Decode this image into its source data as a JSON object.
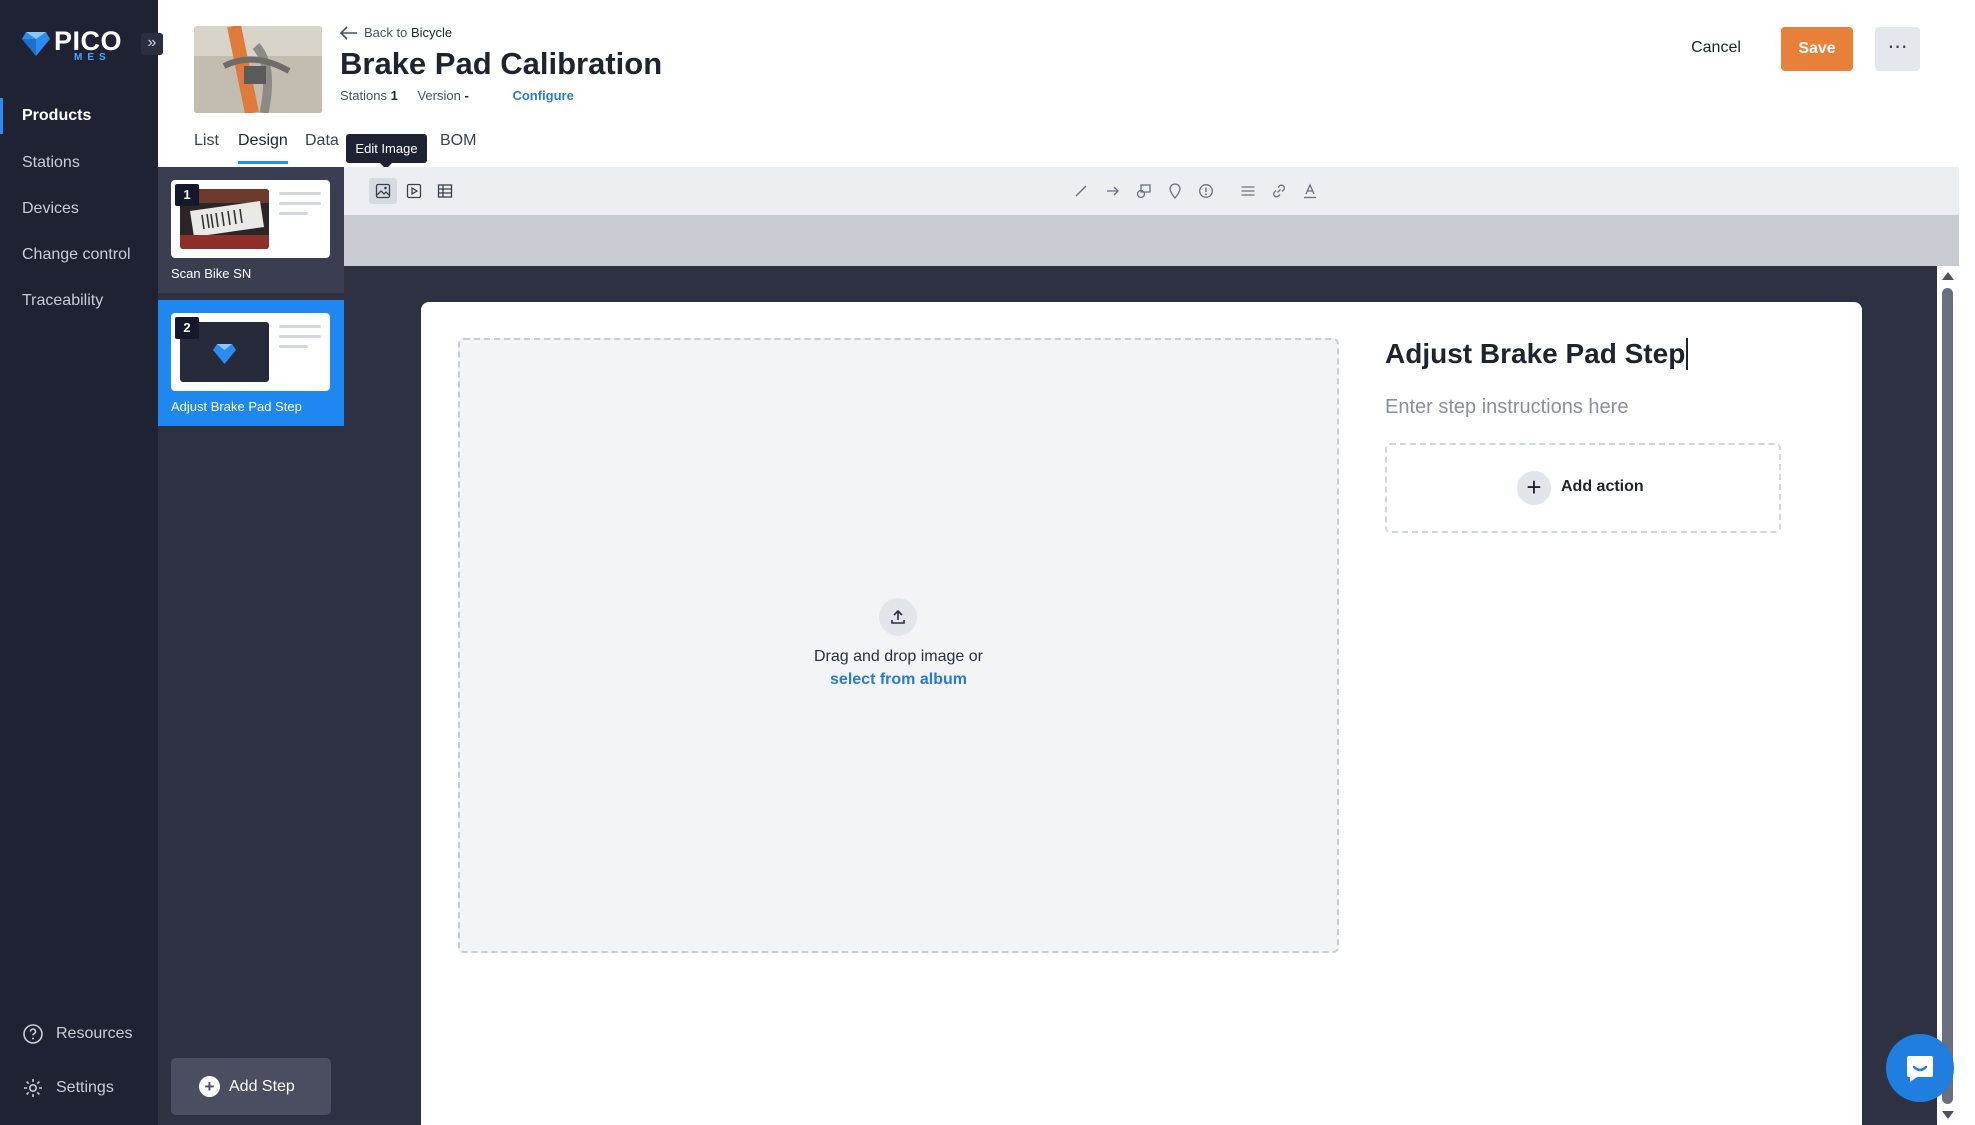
{
  "brand": {
    "name": "PICO",
    "sub": "MES",
    "toggle": "»"
  },
  "nav": {
    "items": [
      "Products",
      "Stations",
      "Devices",
      "Change control",
      "Traceability"
    ],
    "footer": [
      "Resources",
      "Settings"
    ]
  },
  "header": {
    "back_prefix": "Back to",
    "back_target": "Bicycle",
    "title": "Brake Pad Calibration",
    "stations_label": "Stations",
    "stations_value": "1",
    "version_label": "Version",
    "version_value": "-",
    "configure": "Configure",
    "cancel": "Cancel",
    "save": "Save",
    "more": "⋯"
  },
  "tabs": [
    "List",
    "Design",
    "Data",
    "BOM"
  ],
  "tooltip": "Edit Image",
  "steps": [
    {
      "num": "1",
      "label": "Scan Bike SN"
    },
    {
      "num": "2",
      "label": "Adjust Brake Pad Step"
    }
  ],
  "add_step": "Add Step",
  "toolbar_icons": [
    "image-icon",
    "video-icon",
    "table-icon",
    "line-icon",
    "arrow-icon",
    "shape-icon",
    "marker-icon",
    "info-icon",
    "align-icon",
    "link-icon",
    "text-color-icon"
  ],
  "editor": {
    "drop_text": "Drag and drop image or",
    "album_link": "select from album",
    "step_title": "Adjust Brake Pad Step",
    "instructions_placeholder": "Enter step instructions here",
    "add_action": "Add action"
  },
  "colors": {
    "accent": "#1e87f0",
    "save": "#e8803a",
    "nav": "#1f2232"
  }
}
